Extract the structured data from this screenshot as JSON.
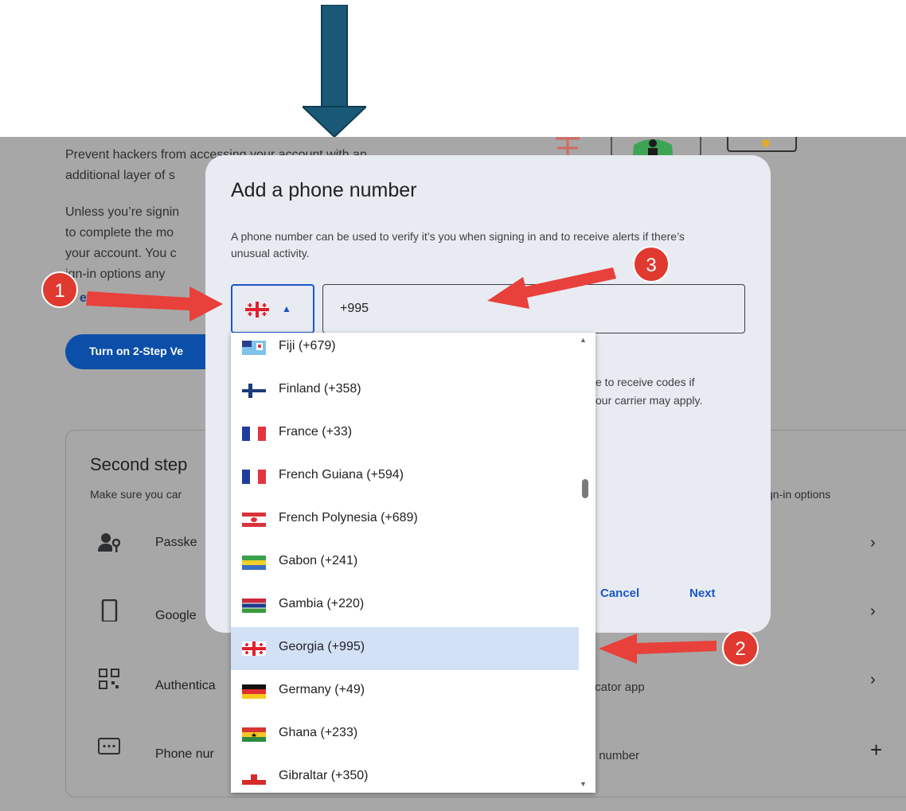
{
  "background": {
    "intro_line1": "Prevent hackers from accessing your account with an",
    "intro_line2": "additional layer of s",
    "para_line1": "Unless you’re signin",
    "para_line2": "to complete the mo",
    "para_line3": "your account. You c",
    "para_line4": "ign-in options any",
    "settings_link": "etting",
    "turn_on_button": "Turn on 2-Step Ve",
    "second_steps": {
      "heading": "Second step",
      "subtext": "Make sure you car",
      "subtext_right": "gn-in options",
      "options": [
        {
          "label": "Passke",
          "right_text": "",
          "icon": "passkey-icon",
          "action": "chevron"
        },
        {
          "label": "Google",
          "right_text": "",
          "icon": "phone-device-icon",
          "action": "chevron"
        },
        {
          "label": "Authentica",
          "right_text": "enticator app",
          "icon": "qr-code-icon",
          "action": "chevron"
        },
        {
          "label": "Phone nur",
          "right_text": "one number",
          "icon": "message-icon",
          "action": "plus"
        }
      ]
    }
  },
  "dialog": {
    "title": "Add a phone number",
    "description": "A phone number can be used to verify it’s you when signing in and to receive alerts if there’s unusual activity.",
    "country_selected": "Georgia",
    "phone_value": "+995",
    "note_line1": "e to receive codes if",
    "note_line2": "our carrier may apply.",
    "cancel_label": "Cancel",
    "next_label": "Next"
  },
  "dropdown": {
    "items": [
      {
        "name": "Fiji (+679)",
        "flag": "fiji"
      },
      {
        "name": "Finland (+358)",
        "flag": "finland"
      },
      {
        "name": "France (+33)",
        "flag": "france"
      },
      {
        "name": "French Guiana (+594)",
        "flag": "french-guiana"
      },
      {
        "name": "French Polynesia (+689)",
        "flag": "french-polynesia"
      },
      {
        "name": "Gabon (+241)",
        "flag": "gabon"
      },
      {
        "name": "Gambia (+220)",
        "flag": "gambia"
      },
      {
        "name": "Georgia (+995)",
        "flag": "georgia",
        "selected": true
      },
      {
        "name": "Germany (+49)",
        "flag": "germany"
      },
      {
        "name": "Ghana (+233)",
        "flag": "ghana"
      },
      {
        "name": "Gibraltar (+350)",
        "flag": "gibraltar"
      }
    ]
  },
  "annotations": {
    "badge_1": "1",
    "badge_2": "2",
    "badge_3": "3",
    "arrow_color": "#e8403a",
    "top_arrow_color": "#1a5877"
  }
}
